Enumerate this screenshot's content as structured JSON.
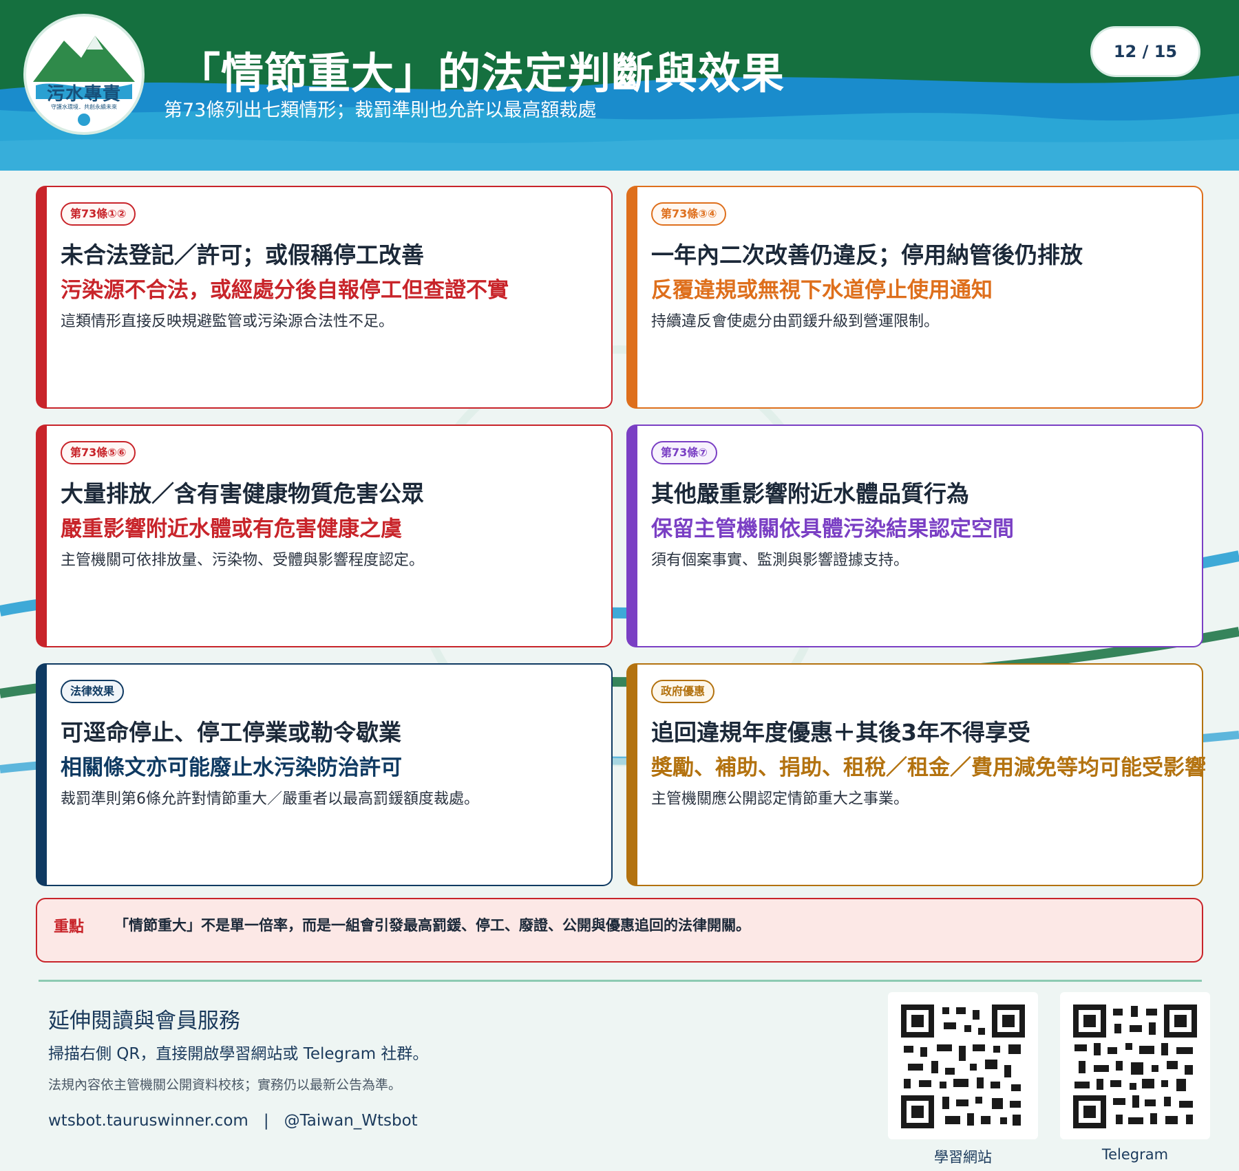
{
  "header": {
    "logo_text": "污水專責",
    "logo_subtitle": "守護水環境．共創永續未來",
    "title": "「情節重大」的法定判斷與效果",
    "subtitle": "第73條列出七類情形；裁罰準則也允許以最高額裁處",
    "page": "12 / 15"
  },
  "colors": {
    "header_green": "#15703f",
    "header_blue": "#1f9bd1",
    "red": "#c8242a",
    "orange": "#de6f1c",
    "purple": "#7a3fc4",
    "navy": "#0f3a62",
    "gold": "#b3720f"
  },
  "cards": [
    {
      "tag": "第73條①②",
      "heading": "未合法登記／許可；或假稱停工改善",
      "highlight": "污染源不合法，或經處分後自報停工但查證不實",
      "description": "這類情形直接反映規避監管或污染源合法性不足。"
    },
    {
      "tag": "第73條③④",
      "heading": "一年內二次改善仍違反；停用納管後仍排放",
      "highlight": "反覆違規或無視下水道停止使用通知",
      "description": "持續違反會使處分由罰鍰升級到營運限制。"
    },
    {
      "tag": "第73條⑤⑥",
      "heading": "大量排放／含有害健康物質危害公眾",
      "highlight": "嚴重影響附近水體或有危害健康之虞",
      "description": "主管機關可依排放量、污染物、受體與影響程度認定。"
    },
    {
      "tag": "第73條⑦",
      "heading": "其他嚴重影響附近水體品質行為",
      "highlight": "保留主管機關依具體污染結果認定空間",
      "description": "須有個案事實、監測與影響證據支持。"
    },
    {
      "tag": "法律效果",
      "heading": "可逕命停止、停工停業或勒令歇業",
      "highlight": "相關條文亦可能廢止水污染防治許可",
      "description": "裁罰準則第6條允許對情節重大／嚴重者以最高罰鍰額度裁處。"
    },
    {
      "tag": "政府優惠",
      "heading": "追回違規年度優惠＋其後3年不得享受",
      "highlight": "獎勵、補助、捐助、租稅／租金／費用減免等均可能受影響",
      "description": "主管機關應公開認定情節重大之事業。"
    }
  ],
  "note": {
    "label": "重點",
    "text": "「情節重大」不是單一倍率，而是一組會引發最高罰鍰、停工、廢證、公開與優惠追回的法律開關。"
  },
  "footer": {
    "title": "延伸閱讀與會員服務",
    "description": "掃描右側 QR，直接開啟學習網站或 Telegram 社群。",
    "disclaimer": "法規內容依主管機關公開資料校核；實務仍以最新公告為準。",
    "website": "wtsbot.tauruswinner.com",
    "separator": "|",
    "telegram_handle": "@Taiwan_Wtsbot",
    "qr_labels": [
      "學習網站",
      "Telegram"
    ]
  }
}
